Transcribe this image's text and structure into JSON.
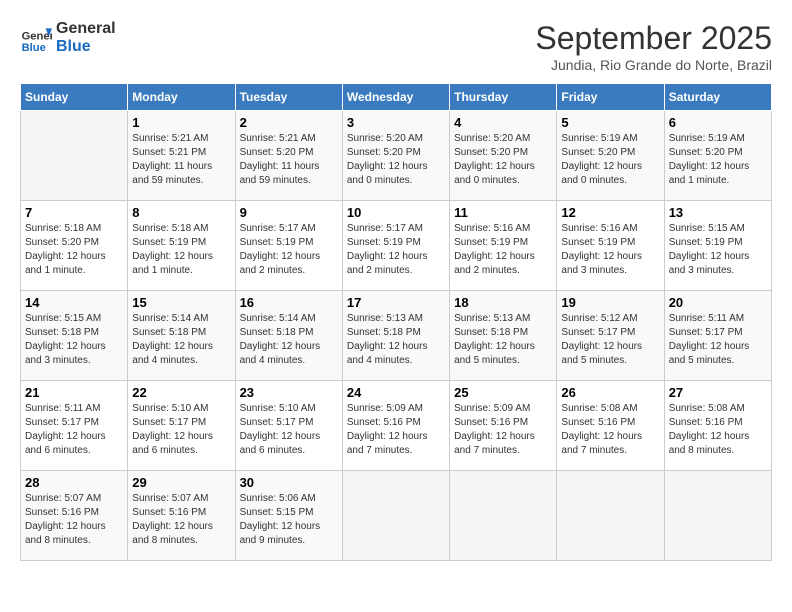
{
  "header": {
    "logo_line1": "General",
    "logo_line2": "Blue",
    "month": "September 2025",
    "location": "Jundia, Rio Grande do Norte, Brazil"
  },
  "weekdays": [
    "Sunday",
    "Monday",
    "Tuesday",
    "Wednesday",
    "Thursday",
    "Friday",
    "Saturday"
  ],
  "weeks": [
    [
      {
        "day": "",
        "info": ""
      },
      {
        "day": "1",
        "info": "Sunrise: 5:21 AM\nSunset: 5:21 PM\nDaylight: 11 hours\nand 59 minutes."
      },
      {
        "day": "2",
        "info": "Sunrise: 5:21 AM\nSunset: 5:20 PM\nDaylight: 11 hours\nand 59 minutes."
      },
      {
        "day": "3",
        "info": "Sunrise: 5:20 AM\nSunset: 5:20 PM\nDaylight: 12 hours\nand 0 minutes."
      },
      {
        "day": "4",
        "info": "Sunrise: 5:20 AM\nSunset: 5:20 PM\nDaylight: 12 hours\nand 0 minutes."
      },
      {
        "day": "5",
        "info": "Sunrise: 5:19 AM\nSunset: 5:20 PM\nDaylight: 12 hours\nand 0 minutes."
      },
      {
        "day": "6",
        "info": "Sunrise: 5:19 AM\nSunset: 5:20 PM\nDaylight: 12 hours\nand 1 minute."
      }
    ],
    [
      {
        "day": "7",
        "info": "Sunrise: 5:18 AM\nSunset: 5:20 PM\nDaylight: 12 hours\nand 1 minute."
      },
      {
        "day": "8",
        "info": "Sunrise: 5:18 AM\nSunset: 5:19 PM\nDaylight: 12 hours\nand 1 minute."
      },
      {
        "day": "9",
        "info": "Sunrise: 5:17 AM\nSunset: 5:19 PM\nDaylight: 12 hours\nand 2 minutes."
      },
      {
        "day": "10",
        "info": "Sunrise: 5:17 AM\nSunset: 5:19 PM\nDaylight: 12 hours\nand 2 minutes."
      },
      {
        "day": "11",
        "info": "Sunrise: 5:16 AM\nSunset: 5:19 PM\nDaylight: 12 hours\nand 2 minutes."
      },
      {
        "day": "12",
        "info": "Sunrise: 5:16 AM\nSunset: 5:19 PM\nDaylight: 12 hours\nand 3 minutes."
      },
      {
        "day": "13",
        "info": "Sunrise: 5:15 AM\nSunset: 5:19 PM\nDaylight: 12 hours\nand 3 minutes."
      }
    ],
    [
      {
        "day": "14",
        "info": "Sunrise: 5:15 AM\nSunset: 5:18 PM\nDaylight: 12 hours\nand 3 minutes."
      },
      {
        "day": "15",
        "info": "Sunrise: 5:14 AM\nSunset: 5:18 PM\nDaylight: 12 hours\nand 4 minutes."
      },
      {
        "day": "16",
        "info": "Sunrise: 5:14 AM\nSunset: 5:18 PM\nDaylight: 12 hours\nand 4 minutes."
      },
      {
        "day": "17",
        "info": "Sunrise: 5:13 AM\nSunset: 5:18 PM\nDaylight: 12 hours\nand 4 minutes."
      },
      {
        "day": "18",
        "info": "Sunrise: 5:13 AM\nSunset: 5:18 PM\nDaylight: 12 hours\nand 5 minutes."
      },
      {
        "day": "19",
        "info": "Sunrise: 5:12 AM\nSunset: 5:17 PM\nDaylight: 12 hours\nand 5 minutes."
      },
      {
        "day": "20",
        "info": "Sunrise: 5:11 AM\nSunset: 5:17 PM\nDaylight: 12 hours\nand 5 minutes."
      }
    ],
    [
      {
        "day": "21",
        "info": "Sunrise: 5:11 AM\nSunset: 5:17 PM\nDaylight: 12 hours\nand 6 minutes."
      },
      {
        "day": "22",
        "info": "Sunrise: 5:10 AM\nSunset: 5:17 PM\nDaylight: 12 hours\nand 6 minutes."
      },
      {
        "day": "23",
        "info": "Sunrise: 5:10 AM\nSunset: 5:17 PM\nDaylight: 12 hours\nand 6 minutes."
      },
      {
        "day": "24",
        "info": "Sunrise: 5:09 AM\nSunset: 5:16 PM\nDaylight: 12 hours\nand 7 minutes."
      },
      {
        "day": "25",
        "info": "Sunrise: 5:09 AM\nSunset: 5:16 PM\nDaylight: 12 hours\nand 7 minutes."
      },
      {
        "day": "26",
        "info": "Sunrise: 5:08 AM\nSunset: 5:16 PM\nDaylight: 12 hours\nand 7 minutes."
      },
      {
        "day": "27",
        "info": "Sunrise: 5:08 AM\nSunset: 5:16 PM\nDaylight: 12 hours\nand 8 minutes."
      }
    ],
    [
      {
        "day": "28",
        "info": "Sunrise: 5:07 AM\nSunset: 5:16 PM\nDaylight: 12 hours\nand 8 minutes."
      },
      {
        "day": "29",
        "info": "Sunrise: 5:07 AM\nSunset: 5:16 PM\nDaylight: 12 hours\nand 8 minutes."
      },
      {
        "day": "30",
        "info": "Sunrise: 5:06 AM\nSunset: 5:15 PM\nDaylight: 12 hours\nand 9 minutes."
      },
      {
        "day": "",
        "info": ""
      },
      {
        "day": "",
        "info": ""
      },
      {
        "day": "",
        "info": ""
      },
      {
        "day": "",
        "info": ""
      }
    ]
  ]
}
